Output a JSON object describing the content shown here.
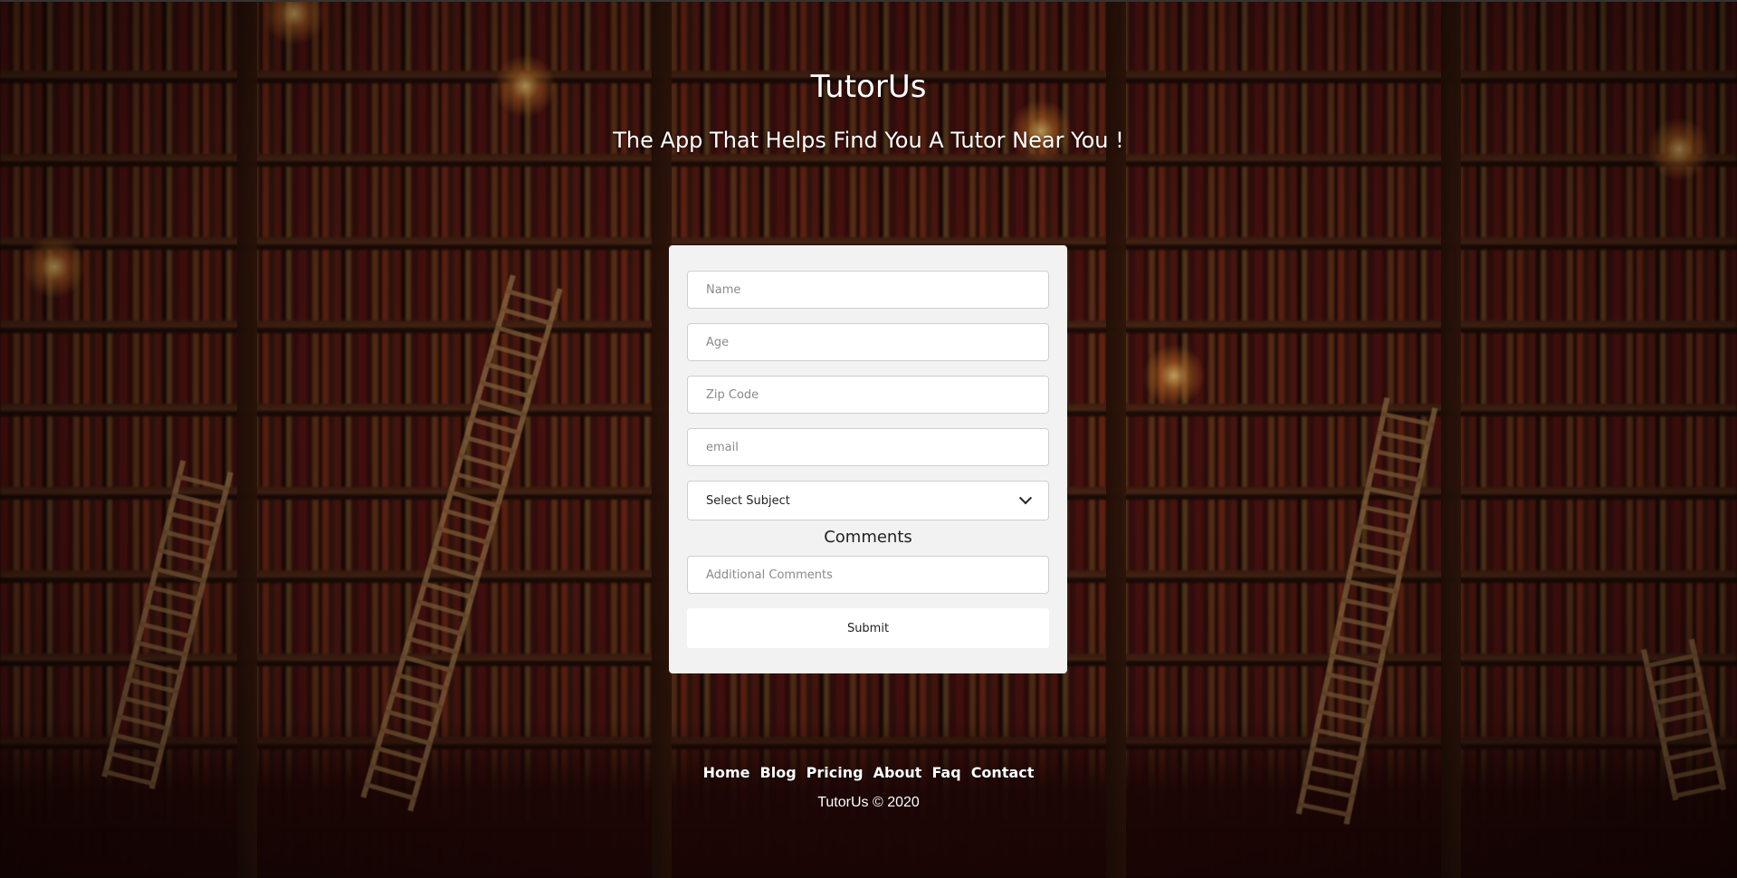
{
  "header": {
    "title": "TutorUs",
    "tagline": "The App That Helps Find You A Tutor Near You !"
  },
  "form": {
    "name_placeholder": "Name",
    "age_placeholder": "Age",
    "zip_placeholder": "Zip Code",
    "email_placeholder": "email",
    "subject_selected": "Select Subject",
    "comments_label": "Comments",
    "comments_placeholder": "Additional Comments",
    "submit_label": "Submit"
  },
  "footer": {
    "nav": [
      "Home",
      "Blog",
      "Pricing",
      "About",
      "Faq",
      "Contact"
    ],
    "copyright": "TutorUs © 2020"
  },
  "colors": {
    "card_background": "#f2f2f2",
    "text_light": "#ffffff"
  }
}
